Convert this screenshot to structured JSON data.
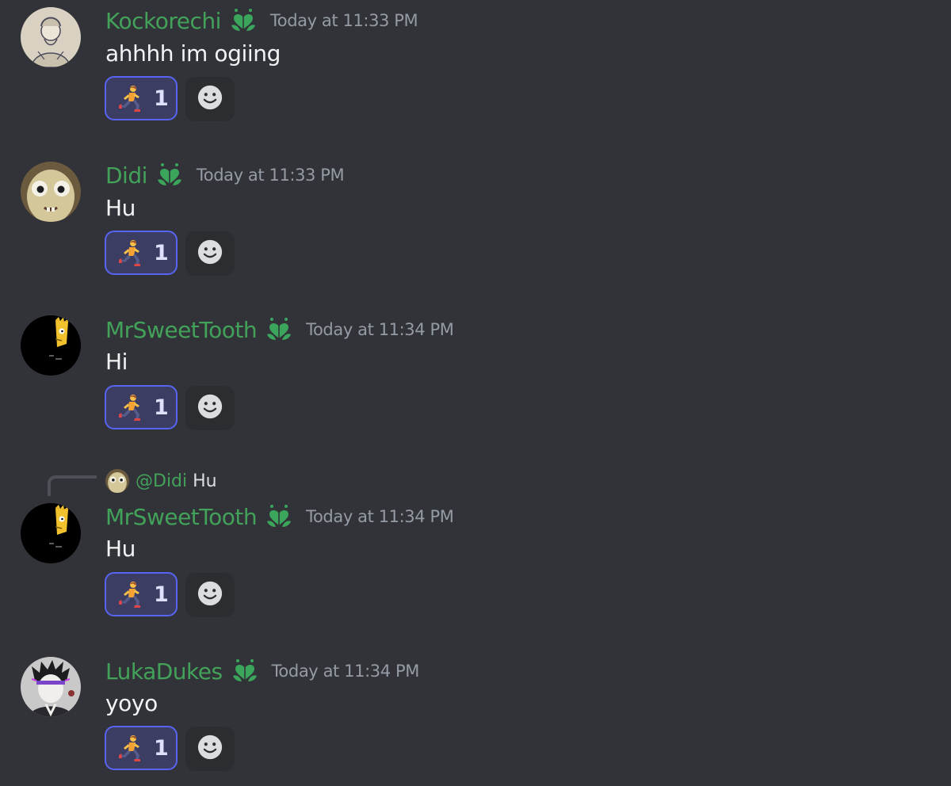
{
  "colors": {
    "background": "#313338",
    "username": "#43a25a",
    "timestamp": "#949ba4",
    "text": "#f2f3f5",
    "reaction_border": "#5865f2",
    "reaction_bg": "#3b3d62"
  },
  "messages": [
    {
      "username": "Kockorechi",
      "role_icon": "green-heart-role-icon",
      "timestamp": "Today at 11:33 PM",
      "content": "ahhhh im ogiing",
      "reaction": {
        "emoji": "person-running-emoji",
        "count": "1"
      }
    },
    {
      "username": "Didi",
      "role_icon": "green-heart-role-icon",
      "timestamp": "Today at 11:33 PM",
      "content": "Hu",
      "reaction": {
        "emoji": "person-running-emoji",
        "count": "1"
      }
    },
    {
      "username": "MrSweetTooth",
      "role_icon": "green-heart-role-icon",
      "timestamp": "Today at 11:34 PM",
      "content": "Hi",
      "reaction": {
        "emoji": "person-running-emoji",
        "count": "1"
      }
    },
    {
      "reply_to": {
        "mention": "@Didi",
        "text": "Hu"
      },
      "username": "MrSweetTooth",
      "role_icon": "green-heart-role-icon",
      "timestamp": "Today at 11:34 PM",
      "content": "Hu",
      "reaction": {
        "emoji": "person-running-emoji",
        "count": "1"
      }
    },
    {
      "username": "LukaDukes",
      "role_icon": "green-heart-role-icon",
      "timestamp": "Today at 11:34 PM",
      "content": "yoyo",
      "reaction": {
        "emoji": "person-running-emoji",
        "count": "1"
      }
    }
  ]
}
